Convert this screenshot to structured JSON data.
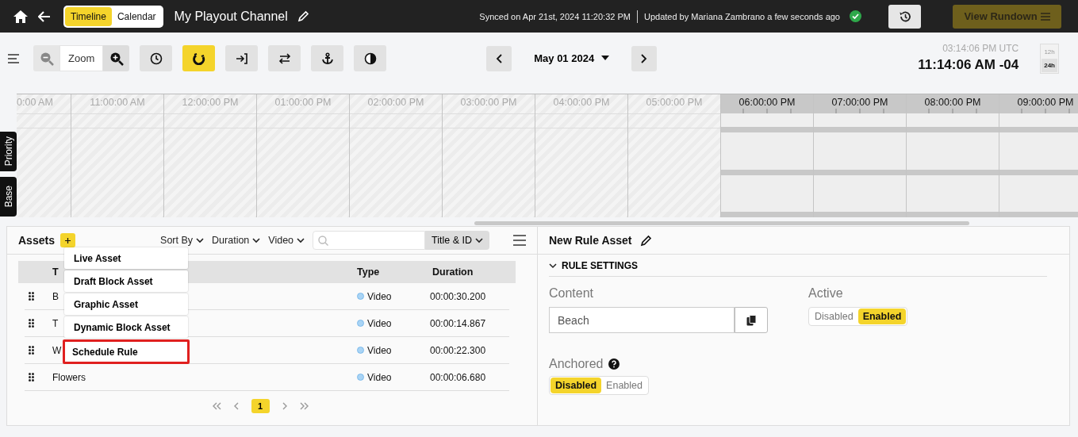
{
  "header": {
    "view_tabs": [
      {
        "label": "Timeline",
        "selected": true
      },
      {
        "label": "Calendar",
        "selected": false
      }
    ],
    "channel_title": "My Playout Channel",
    "sync_status": "Synced on Apr 21st, 2024 11:20:32 PM",
    "update_status": "Updated by Mariana Zambrano a few seconds ago",
    "rundown_button": {
      "label": "View Rundown",
      "disabled": true
    }
  },
  "toolbar": {
    "zoom_label": "Zoom",
    "tools": [
      {
        "kind": "clock",
        "selected": false
      },
      {
        "kind": "magnet",
        "selected": true
      },
      {
        "kind": "enter",
        "selected": false
      },
      {
        "kind": "swap",
        "selected": false
      },
      {
        "kind": "anchor",
        "selected": false
      },
      {
        "kind": "contrast",
        "selected": false
      }
    ],
    "date": "May 01 2024",
    "utc_time": "03:14:06 PM UTC",
    "local_time": "11:14:06 AM -04",
    "time_formats": [
      {
        "label": "12h",
        "selected": false
      },
      {
        "label": "24h",
        "selected": true
      }
    ]
  },
  "timeline": {
    "hours": [
      {
        "label": "0:00 AM",
        "past": true
      },
      {
        "label": "11:00:00 AM",
        "past": true
      },
      {
        "label": "12:00:00 PM",
        "past": true
      },
      {
        "label": "01:00:00 PM",
        "past": true
      },
      {
        "label": "02:00:00 PM",
        "past": true
      },
      {
        "label": "03:00:00 PM",
        "past": true
      },
      {
        "label": "04:00:00 PM",
        "past": true
      },
      {
        "label": "05:00:00 PM",
        "past": true
      },
      {
        "label": "06:00:00 PM",
        "past": false
      },
      {
        "label": "07:00:00 PM",
        "past": false
      },
      {
        "label": "08:00:00 PM",
        "past": false
      },
      {
        "label": "09:00:00 PM",
        "past": false
      }
    ],
    "tracks": [
      "Priority",
      "Base"
    ]
  },
  "assets": {
    "title": "Assets",
    "filters": [
      "Sort By",
      "Duration",
      "Video"
    ],
    "search_scope": "Title & ID",
    "add_menu": [
      {
        "label": "Live Asset",
        "highlighted": false
      },
      {
        "label": "Draft Block Asset",
        "highlighted": false
      },
      {
        "label": "Graphic Asset",
        "highlighted": false
      },
      {
        "label": "Dynamic Block Asset",
        "highlighted": false
      },
      {
        "label": "Schedule Rule",
        "highlighted": true
      }
    ],
    "columns": [
      "T",
      "Type",
      "Duration"
    ],
    "rows": [
      {
        "title": "B",
        "type": "Video",
        "duration": "00:00:30.200"
      },
      {
        "title": "T",
        "type": "Video",
        "duration": "00:00:14.867"
      },
      {
        "title": "W",
        "type": "Video",
        "duration": "00:00:22.300"
      },
      {
        "title": "Flowers",
        "type": "Video",
        "duration": "00:00:06.680"
      }
    ],
    "pages": [
      {
        "label": "1",
        "selected": true
      }
    ]
  },
  "rule_panel": {
    "title": "New Rule Asset",
    "section": {
      "label": "RULE SETTINGS",
      "expanded": true
    },
    "content": {
      "label": "Content",
      "value": "Beach"
    },
    "active": {
      "label": "Active",
      "options": [
        {
          "label": "Disabled",
          "selected": false
        },
        {
          "label": "Enabled",
          "selected": true
        }
      ]
    },
    "anchored": {
      "label": "Anchored",
      "options": [
        {
          "label": "Disabled",
          "selected": true
        },
        {
          "label": "Enabled",
          "selected": false
        }
      ]
    }
  }
}
